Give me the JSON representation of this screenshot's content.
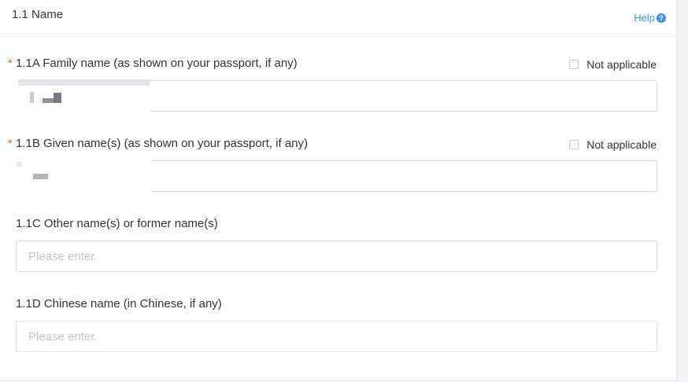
{
  "section": {
    "title": "1.1 Name",
    "help_label": "Help",
    "help_icon": "question-circle-icon"
  },
  "fields": {
    "family_name": {
      "required": "*",
      "label": "1.1A Family name (as shown on your passport, if any)",
      "not_applicable_label": "Not applicable",
      "value": ""
    },
    "given_name": {
      "required": "*",
      "label": "1.1B Given name(s) (as shown on your passport, if any)",
      "not_applicable_label": "Not applicable",
      "value": ""
    },
    "other_names": {
      "label": "1.1C Other name(s) or former name(s)",
      "placeholder": "Please enter."
    },
    "chinese_name": {
      "label": "1.1D Chinese name (in Chinese, if any)",
      "placeholder": "Please enter."
    }
  },
  "colors": {
    "accent": "#3c93e8",
    "required": "#e8553e",
    "border": "#dcdfe6",
    "placeholder": "#c0c4cc"
  }
}
